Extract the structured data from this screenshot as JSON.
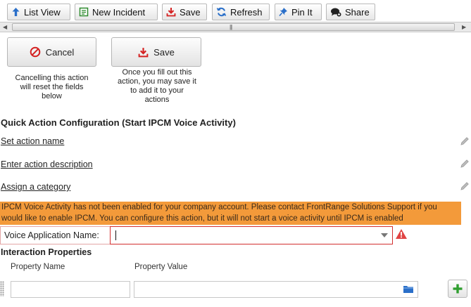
{
  "toolbar": {
    "items": [
      {
        "label": "List View",
        "icon": "arrow-up-icon"
      },
      {
        "label": "New Incident",
        "icon": "new-form-icon"
      },
      {
        "label": "Save",
        "icon": "save-download-icon"
      },
      {
        "label": "Refresh",
        "icon": "refresh-icon"
      },
      {
        "label": "Pin It",
        "icon": "pin-icon"
      },
      {
        "label": "Share",
        "icon": "share-chat-icon"
      }
    ]
  },
  "scrollbar": {
    "grip": "|||"
  },
  "actions": {
    "cancel": {
      "label": "Cancel",
      "hint_lines": [
        "Cancelling this action",
        "will reset the fields",
        "below"
      ]
    },
    "save": {
      "label": "Save",
      "hint_lines": [
        "Once you fill out this",
        "action, you may save it",
        "to add it to your",
        "actions"
      ]
    }
  },
  "config": {
    "title": "Quick Action Configuration (Start IPCM Voice Activity)",
    "action_name": "Set action name",
    "action_description": "Enter action description",
    "category": "Assign a category"
  },
  "warning": {
    "lines": [
      " IPCM Voice Activity has not been enabled for your company account. Please contact FrontRange Solutions Support if you",
      "would like to enable IPCM. You can configure this action, but it will not start a voice activity until IPCM is enabled"
    ]
  },
  "voice_app": {
    "label": "Voice Application Name:",
    "value": ""
  },
  "interaction": {
    "title": "Interaction Properties",
    "columns": [
      "Property Name",
      "Property Value"
    ],
    "property_name_value": "",
    "property_value_value": ""
  },
  "colors": {
    "warning_bg": "#f39a3a",
    "error_border": "#d32f2f",
    "add_green": "#2e9e2e",
    "icon_blue": "#2a6fc9"
  }
}
